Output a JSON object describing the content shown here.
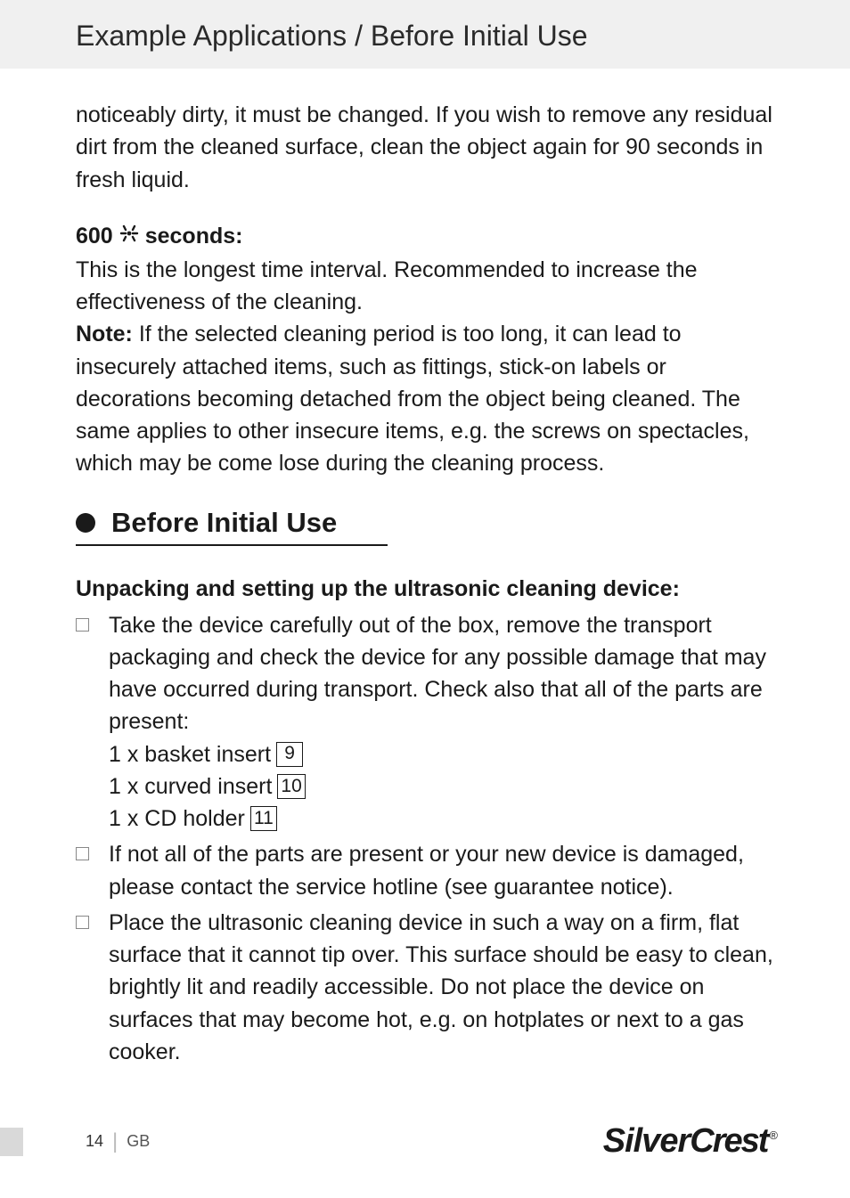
{
  "header": {
    "title": "Example Applications / Before Initial Use"
  },
  "intro_continuation": "noticeably dirty, it must be changed. If you wish to remove any residual dirt from the cleaned surface, clean the object again for 90 seconds in fresh liquid.",
  "timer600": {
    "label_prefix": "600",
    "label_suffix": "seconds:",
    "desc": "This is the longest time interval. Recommended to increase the effectiveness of the cleaning."
  },
  "note": {
    "label": "Note:",
    "text": " If the selected cleaning period is too long, it can lead to insecurely attached items, such as fittings, stick-on labels or decorations becoming detached from the object being cleaned. The same applies to other insecure items, e.g. the screws on spectacles, which may be come lose during the cleaning process."
  },
  "section": {
    "title": "Before Initial Use",
    "subhead": "Unpacking and setting up the ultrasonic cleaning device:"
  },
  "steps": [
    {
      "text": "Take the device carefully out of the box, remove the transport packaging and check the device for any possible damage that may have occurred during transport. Check also that all of the parts are present:",
      "parts": [
        {
          "label": "1 x basket insert",
          "ref": "9"
        },
        {
          "label": "1 x curved insert",
          "ref": "10"
        },
        {
          "label": "1 x CD holder",
          "ref": "11"
        }
      ]
    },
    {
      "text": "If not all of the parts are present or your new device is damaged, please contact the service hotline (see guarantee notice)."
    },
    {
      "text": "Place the ultrasonic cleaning device in such a way on a firm, flat surface that it cannot tip over. This surface should be easy to clean, brightly lit and readily accessible. Do not place the device on surfaces that may become hot, e.g. on hotplates or next to a gas cooker."
    }
  ],
  "footer": {
    "page": "14",
    "region": "GB",
    "brand_a": "Silver",
    "brand_b": "Crest",
    "reg": "®"
  }
}
